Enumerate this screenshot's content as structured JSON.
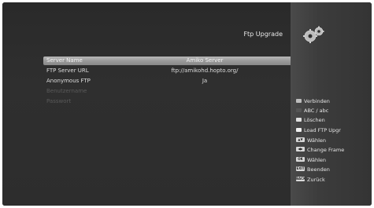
{
  "header": {
    "title": "Ftp Upgrade",
    "gear_icon": "gears-icon"
  },
  "settings": [
    {
      "label": "Server Name",
      "value": "Amiko Server"
    },
    {
      "label": "FTP Server URL",
      "value": "ftp://amikohd.hopto.org/"
    },
    {
      "label": "Anonymous FTP",
      "value": "Ja"
    },
    {
      "label": "Benutzername",
      "value": ""
    },
    {
      "label": "Passwort",
      "value": ""
    }
  ],
  "legend": {
    "red": "Verbinden",
    "green": "ABC / abc",
    "yellow": "Löschen",
    "blue": "Load FTP Upgr",
    "nav": "Wählen",
    "frame": "Change Frame",
    "ok_key": "OK",
    "ok": "Wählen",
    "exit_key": "EXIT",
    "exit": "Beenden",
    "back_key": "BACK",
    "back": "Zurück"
  }
}
